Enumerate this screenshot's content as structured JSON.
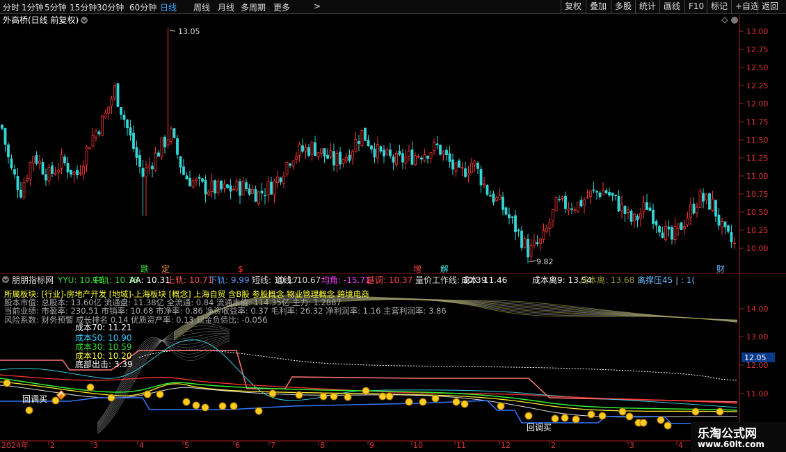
{
  "toolbar": {
    "timeframes": [
      "分时",
      "1分钟",
      "5分钟",
      "15分钟",
      "30分钟",
      "60分钟",
      "日线",
      "周线",
      "月线",
      "多周期",
      "更多"
    ],
    "active_timeframe": "日线",
    "more_arrow": ">",
    "buttons": [
      "复权",
      "叠加",
      "多股",
      "统计",
      "画线",
      "F10",
      "标记",
      "+自选",
      "返回"
    ]
  },
  "main_chart": {
    "title": "外高桥(日线 前复权)",
    "y_ticks": [
      "13.00",
      "12.75",
      "12.50",
      "12.25",
      "12.00",
      "11.75",
      "11.50",
      "11.25",
      "11.00",
      "10.75",
      "10.50",
      "10.25",
      "10.00"
    ],
    "high_label": "13.05",
    "low_label": "9.82",
    "markers": [
      {
        "text": "跌",
        "color": "#33dd33"
      },
      {
        "text": "定",
        "color": "#ff9933"
      },
      {
        "text": "$",
        "color": "#ff3333"
      },
      {
        "text": "增",
        "color": "#ff4444"
      },
      {
        "text": "解",
        "color": "#44dddd"
      },
      {
        "text": "财",
        "color": "#66bbff"
      }
    ],
    "colors": {
      "up": "#ff3333",
      "down": "#33d6d6",
      "axis": "#cc3333"
    }
  },
  "indicator_bar": {
    "name": "朋朋指标网",
    "items": [
      {
        "label": "YYU: 10.11",
        "color": "#33dd33"
      },
      {
        "label": "中轨: 10.36",
        "color": "#33dd33"
      },
      {
        "label": "AA: 10.31",
        "color": "#ffffff"
      },
      {
        "label": "上轨: 10.71",
        "color": "#ff5555"
      },
      {
        "label": "下轨: 9.99",
        "color": "#5599ff"
      },
      {
        "label": "短线: 10.17",
        "color": "#dddddd"
      },
      {
        "label": "道线: 10.67",
        "color": "#dddddd"
      },
      {
        "label": "均角: -15.71",
        "color": "#ff44ff"
      },
      {
        "label": "基调: 10.37",
        "color": "#ff4444"
      },
      {
        "label": "量价工作线: 10.39",
        "color": "#dddddd"
      },
      {
        "label": "成本: 11.46",
        "color": "#ffffff"
      },
      {
        "label": "成本离9: 13.54",
        "color": "#ffffff"
      },
      {
        "label": "成本离: 13.68",
        "color": "#999933"
      },
      {
        "label": "离撑压45 | : 1(",
        "color": "#66bbff"
      }
    ]
  },
  "info_lines": [
    {
      "text": "所属板块: [行业]-房地产开发 [地域]-上海板块 [概念] 上海自贸 含B股 参股概念 物业管理概念 跨境电商",
      "color": "#ffff33"
    },
    {
      "text": "股本市值: 总股本: 13.60亿 流通盘: 11.38亿 全流通: 0.84 流通市值: 114.35亿 主力: 1.2887",
      "color": "#aaaaaa"
    },
    {
      "text": "当前业绩: 市盈率: 230.51 市销率: 10.68 市净率: 0.86 净资收益率: 0.37 毛利率: 26.32 净利润率: 1.16 主营利润率: 3.86",
      "color": "#aaaaaa"
    },
    {
      "text": "风险系数: 财务预警 成长排名 0.14 优质资产率: 0.13 现金负债比: -0.056",
      "color": "#aaaaaa"
    }
  ],
  "cost_lines": [
    {
      "text": "成本70: 11.21",
      "color": "#ffffff"
    },
    {
      "text": "成本50: 10.90",
      "color": "#33ccff"
    },
    {
      "text": "成本30: 10.59",
      "color": "#33dd33"
    },
    {
      "text": "成本10: 10.20",
      "color": "#ffff33"
    },
    {
      "text": "底部出击: 3.39",
      "color": "#ffffff"
    }
  ],
  "ind_y_ticks": [
    "14.00",
    "13.00",
    "12.00",
    "11.00"
  ],
  "ind_price_tag": "12.05",
  "signal_labels": [
    "回调买",
    "回调买"
  ],
  "x_axis": {
    "year_label": "2024年",
    "months": [
      "2",
      "3",
      "4",
      "5",
      "6",
      "7",
      "8",
      "9",
      "10",
      "11",
      "12",
      "2",
      "3",
      "4"
    ]
  },
  "watermark": {
    "line1": "乐淘公式网",
    "line2": "www.60lt.com"
  }
}
